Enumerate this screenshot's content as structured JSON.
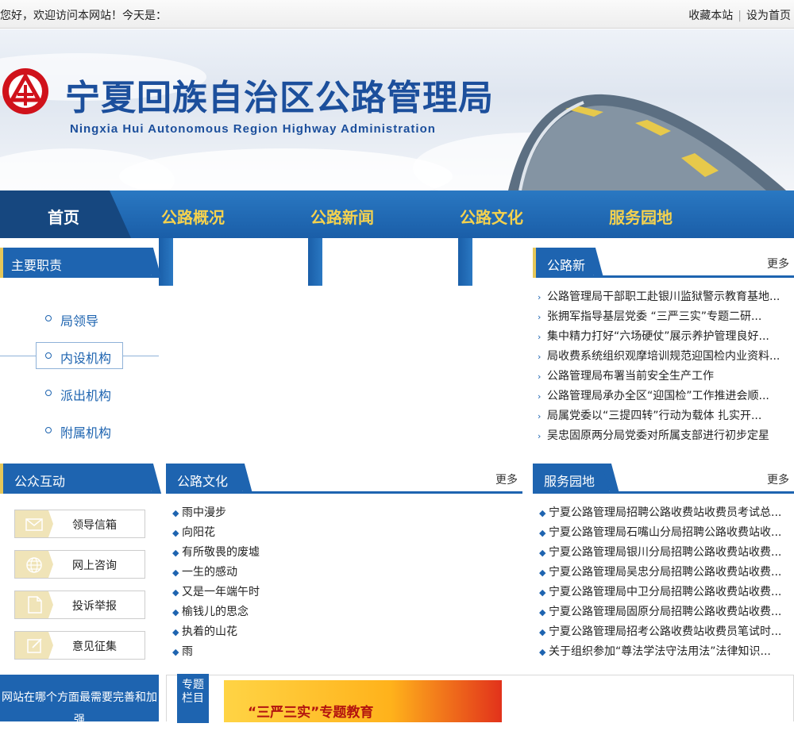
{
  "topbar": {
    "welcome": "您好，欢迎访问本网站！今天是：",
    "bookmark": "收藏本站",
    "sethome": "设为首页"
  },
  "banner": {
    "title": "宁夏回族自治区公路管理局",
    "subtitle": "Ningxia Hui Autonomous Region Highway Administration"
  },
  "nav": {
    "items": [
      "首页",
      "公路概况",
      "公路新闻",
      "公路文化",
      "服务园地"
    ]
  },
  "duty": {
    "title": "主要职责",
    "items": [
      "局领导",
      "内设机构",
      "派出机构",
      "附属机构"
    ]
  },
  "news": {
    "title": "公路新闻",
    "more": "更多",
    "items": [
      "公路管理局干部职工赴银川监狱警示教育基地...",
      "张拥军指导基层党委 “三严三实”专题二研...",
      "集中精力打好“六场硬仗”展示养护管理良好...",
      "局收费系统组织观摩培训规范迎国检内业资料...",
      "公路管理局布署当前安全生产工作",
      "公路管理局承办全区“迎国检”工作推进会顺...",
      "局属党委以“三提四转”行动为载体 扎实开...",
      "吴忠固原两分局党委对所属支部进行初步定星"
    ]
  },
  "interact": {
    "title": "公众互动",
    "buttons": [
      "领导信箱",
      "网上咨询",
      "投诉举报",
      "意见征集"
    ],
    "ask": "网站在哪个方面最需要完善和加强"
  },
  "culture": {
    "title": "公路文化",
    "more": "更多",
    "items": [
      "雨中漫步",
      "向阳花",
      "有所敬畏的废墟",
      "一生的感动",
      "又是一年端午时",
      "榆钱儿的思念",
      "执着的山花",
      "雨"
    ]
  },
  "service": {
    "title": "服务园地",
    "more": "更多",
    "items": [
      "宁夏公路管理局招聘公路收费站收费员考试总...",
      "宁夏公路管理局石嘴山分局招聘公路收费站收...",
      "宁夏公路管理局银川分局招聘公路收费站收费...",
      "宁夏公路管理局吴忠分局招聘公路收费站收费...",
      "宁夏公路管理局中卫分局招聘公路收费站收费...",
      "宁夏公路管理局固原分局招聘公路收费站收费...",
      "宁夏公路管理局招考公路收费站收费员笔试时...",
      "关于组织参加“尊法学法守法用法”法律知识..."
    ]
  },
  "special": {
    "tab": "专题栏目",
    "banner": "“三严三实”专题教育"
  },
  "icons": {
    "mail": "mail-icon",
    "globe": "globe-icon",
    "doc": "document-icon",
    "edit": "edit-icon",
    "logo": "logo-icon"
  },
  "colors": {
    "primary": "#1e64b0",
    "nav_text": "#f5d24e",
    "logo_red": "#d0121b"
  }
}
